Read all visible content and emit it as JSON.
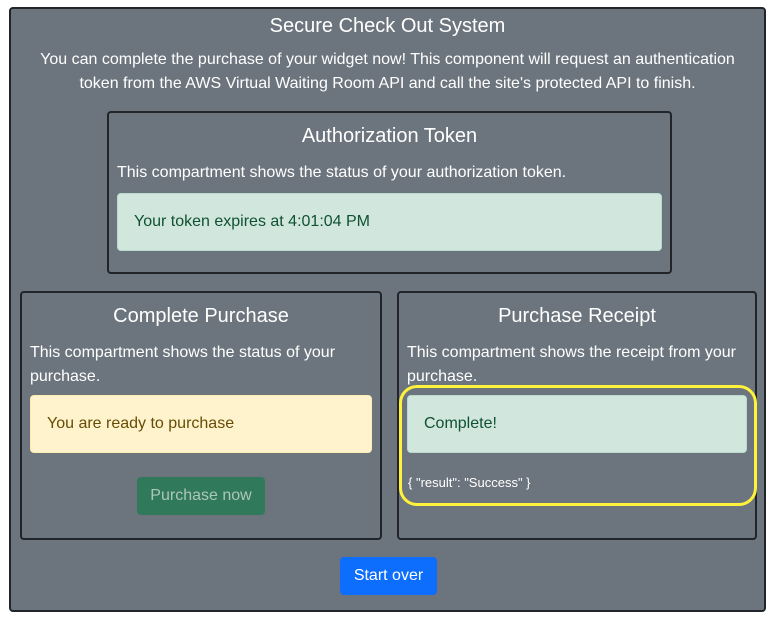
{
  "page": {
    "title": "Secure Check Out System",
    "intro": "You can complete the purchase of your widget now! This component will request an authentication token from the AWS Virtual Waiting Room API and call the site's protected API to finish."
  },
  "token_card": {
    "title": "Authorization Token",
    "description": "This compartment shows the status of your authorization token.",
    "status": "Your token expires at 4:01:04 PM"
  },
  "purchase_card": {
    "title": "Complete Purchase",
    "description": "This compartment shows the status of your purchase.",
    "status": "You are ready to purchase",
    "button_label": "Purchase now"
  },
  "receipt_card": {
    "title": "Purchase Receipt",
    "description": "This compartment shows the receipt from your purchase.",
    "status": "Complete!",
    "result": "{ \"result\": \"Success\" }"
  },
  "footer": {
    "start_over_label": "Start over"
  },
  "colors": {
    "panel_bg": "#6c757d",
    "success_bg": "#d1e7dd",
    "warning_bg": "#fff3cd",
    "primary_button": "#0d6efd",
    "highlight": "#fff23a"
  }
}
